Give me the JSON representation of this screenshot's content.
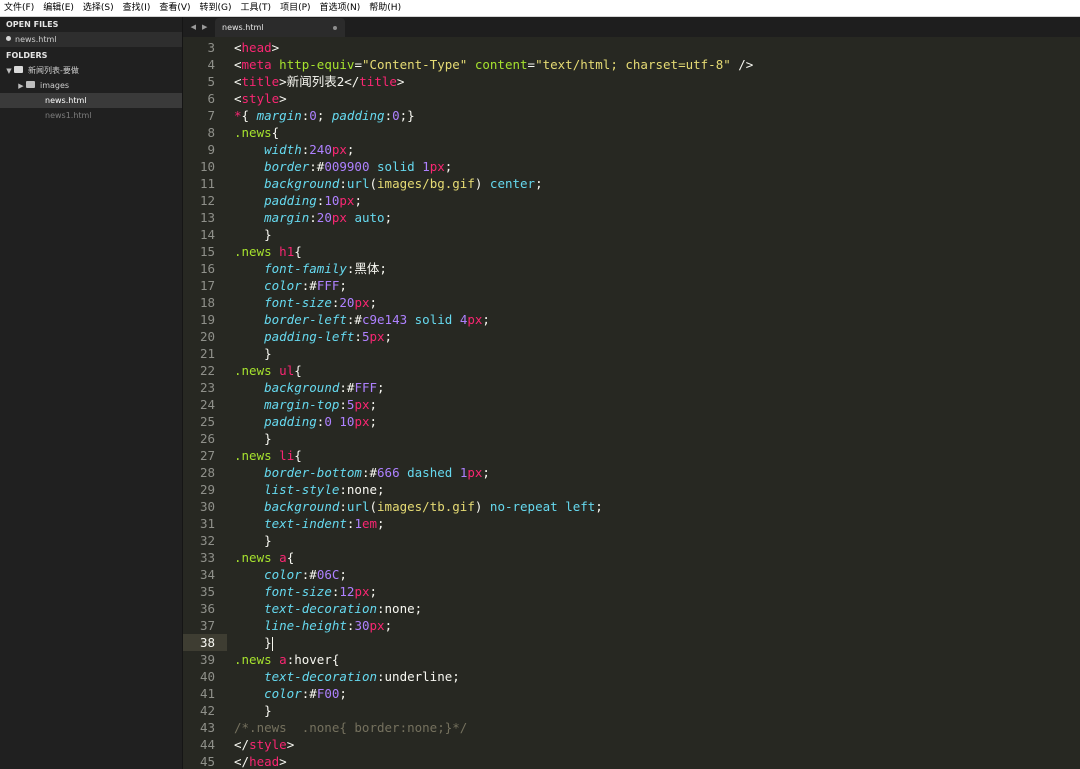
{
  "menu": [
    "文件(F)",
    "编辑(E)",
    "选择(S)",
    "查找(I)",
    "查看(V)",
    "转到(G)",
    "工具(T)",
    "项目(P)",
    "首选项(N)",
    "帮助(H)"
  ],
  "sidebar": {
    "open_files_header": "OPEN FILES",
    "open_files": [
      "news.html"
    ],
    "folders_header": "FOLDERS",
    "root_folder": "新闻列表-要做",
    "subfolder": "images",
    "files": [
      "news.html",
      "news1.html"
    ]
  },
  "tab": {
    "label": "news.html"
  },
  "editor": {
    "line_numbers": [
      "3",
      "4",
      "5",
      "6",
      "7",
      "8",
      "9",
      "10",
      "11",
      "12",
      "13",
      "14",
      "15",
      "16",
      "17",
      "18",
      "19",
      "20",
      "21",
      "22",
      "23",
      "24",
      "25",
      "26",
      "27",
      "28",
      "29",
      "30",
      "31",
      "32",
      "33",
      "34",
      "35",
      "36",
      "37",
      "38",
      "39",
      "40",
      "41",
      "42",
      "43",
      "44",
      "45"
    ],
    "active_line": "38",
    "lines": [
      [
        [
          "t",
          "<"
        ],
        [
          "tag",
          "head"
        ],
        [
          "t",
          ">"
        ]
      ],
      [
        [
          "t",
          "<"
        ],
        [
          "tag",
          "meta"
        ],
        [
          "t",
          " "
        ],
        [
          "attr",
          "http-equiv"
        ],
        [
          "t",
          "="
        ],
        [
          "str",
          "\"Content-Type\""
        ],
        [
          "t",
          " "
        ],
        [
          "attr",
          "content"
        ],
        [
          "t",
          "="
        ],
        [
          "str",
          "\"text/html; charset=utf-8\""
        ],
        [
          "t",
          " />"
        ]
      ],
      [
        [
          "t",
          "<"
        ],
        [
          "tag",
          "title"
        ],
        [
          "t",
          ">新闻列表2</"
        ],
        [
          "tag",
          "title"
        ],
        [
          "t",
          ">"
        ]
      ],
      [
        [
          "t",
          "<"
        ],
        [
          "tag",
          "style"
        ],
        [
          "t",
          ">"
        ]
      ],
      [
        [
          "tag",
          "*"
        ],
        [
          "t",
          "{ "
        ],
        [
          "prop",
          "margin"
        ],
        [
          "t",
          ":"
        ],
        [
          "num",
          "0"
        ],
        [
          "t",
          "; "
        ],
        [
          "prop",
          "padding"
        ],
        [
          "t",
          ":"
        ],
        [
          "num",
          "0"
        ],
        [
          "t",
          ";}"
        ]
      ],
      [
        [
          "sel",
          ".news"
        ],
        [
          "t",
          "{"
        ]
      ],
      [
        [
          "t",
          "    "
        ],
        [
          "prop",
          "width"
        ],
        [
          "t",
          ":"
        ],
        [
          "num",
          "240"
        ],
        [
          "unit",
          "px"
        ],
        [
          "t",
          ";"
        ]
      ],
      [
        [
          "t",
          "    "
        ],
        [
          "prop",
          "border"
        ],
        [
          "t",
          ":#"
        ],
        [
          "num",
          "009900"
        ],
        [
          "t",
          " "
        ],
        [
          "val",
          "solid"
        ],
        [
          "t",
          " "
        ],
        [
          "num",
          "1"
        ],
        [
          "unit",
          "px"
        ],
        [
          "t",
          ";"
        ]
      ],
      [
        [
          "t",
          "    "
        ],
        [
          "prop",
          "background"
        ],
        [
          "t",
          ":"
        ],
        [
          "fn",
          "url"
        ],
        [
          "t",
          "("
        ],
        [
          "str",
          "images/bg.gif"
        ],
        [
          "t",
          ") "
        ],
        [
          "val",
          "center"
        ],
        [
          "t",
          ";"
        ]
      ],
      [
        [
          "t",
          "    "
        ],
        [
          "prop",
          "padding"
        ],
        [
          "t",
          ":"
        ],
        [
          "num",
          "10"
        ],
        [
          "unit",
          "px"
        ],
        [
          "t",
          ";"
        ]
      ],
      [
        [
          "t",
          "    "
        ],
        [
          "prop",
          "margin"
        ],
        [
          "t",
          ":"
        ],
        [
          "num",
          "20"
        ],
        [
          "unit",
          "px"
        ],
        [
          "t",
          " "
        ],
        [
          "val",
          "auto"
        ],
        [
          "t",
          ";"
        ]
      ],
      [
        [
          "t",
          "    }"
        ]
      ],
      [
        [
          "sel",
          ".news"
        ],
        [
          "t",
          " "
        ],
        [
          "tag",
          "h1"
        ],
        [
          "t",
          "{"
        ]
      ],
      [
        [
          "t",
          "    "
        ],
        [
          "prop",
          "font-family"
        ],
        [
          "t",
          ":黑体;"
        ]
      ],
      [
        [
          "t",
          "    "
        ],
        [
          "prop",
          "color"
        ],
        [
          "t",
          ":#"
        ],
        [
          "num",
          "FFF"
        ],
        [
          "t",
          ";"
        ]
      ],
      [
        [
          "t",
          "    "
        ],
        [
          "prop",
          "font-size"
        ],
        [
          "t",
          ":"
        ],
        [
          "num",
          "20"
        ],
        [
          "unit",
          "px"
        ],
        [
          "t",
          ";"
        ]
      ],
      [
        [
          "t",
          "    "
        ],
        [
          "prop",
          "border-left"
        ],
        [
          "t",
          ":#"
        ],
        [
          "num",
          "c9e143"
        ],
        [
          "t",
          " "
        ],
        [
          "val",
          "solid"
        ],
        [
          "t",
          " "
        ],
        [
          "num",
          "4"
        ],
        [
          "unit",
          "px"
        ],
        [
          "t",
          ";"
        ]
      ],
      [
        [
          "t",
          "    "
        ],
        [
          "prop",
          "padding-left"
        ],
        [
          "t",
          ":"
        ],
        [
          "num",
          "5"
        ],
        [
          "unit",
          "px"
        ],
        [
          "t",
          ";"
        ]
      ],
      [
        [
          "t",
          "    }"
        ]
      ],
      [
        [
          "sel",
          ".news"
        ],
        [
          "t",
          " "
        ],
        [
          "tag",
          "ul"
        ],
        [
          "t",
          "{"
        ]
      ],
      [
        [
          "t",
          "    "
        ],
        [
          "prop",
          "background"
        ],
        [
          "t",
          ":#"
        ],
        [
          "num",
          "FFF"
        ],
        [
          "t",
          ";"
        ]
      ],
      [
        [
          "t",
          "    "
        ],
        [
          "prop",
          "margin-top"
        ],
        [
          "t",
          ":"
        ],
        [
          "num",
          "5"
        ],
        [
          "unit",
          "px"
        ],
        [
          "t",
          ";"
        ]
      ],
      [
        [
          "t",
          "    "
        ],
        [
          "prop",
          "padding"
        ],
        [
          "t",
          ":"
        ],
        [
          "num",
          "0"
        ],
        [
          "t",
          " "
        ],
        [
          "num",
          "10"
        ],
        [
          "unit",
          "px"
        ],
        [
          "t",
          ";"
        ]
      ],
      [
        [
          "t",
          "    }"
        ]
      ],
      [
        [
          "sel",
          ".news"
        ],
        [
          "t",
          " "
        ],
        [
          "tag",
          "li"
        ],
        [
          "t",
          "{"
        ]
      ],
      [
        [
          "t",
          "    "
        ],
        [
          "prop",
          "border-bottom"
        ],
        [
          "t",
          ":#"
        ],
        [
          "num",
          "666"
        ],
        [
          "t",
          " "
        ],
        [
          "val",
          "dashed"
        ],
        [
          "t",
          " "
        ],
        [
          "num",
          "1"
        ],
        [
          "unit",
          "px"
        ],
        [
          "t",
          ";"
        ]
      ],
      [
        [
          "t",
          "    "
        ],
        [
          "prop",
          "list-style"
        ],
        [
          "t",
          ":none;"
        ]
      ],
      [
        [
          "t",
          "    "
        ],
        [
          "prop",
          "background"
        ],
        [
          "t",
          ":"
        ],
        [
          "fn",
          "url"
        ],
        [
          "t",
          "("
        ],
        [
          "str",
          "images/tb.gif"
        ],
        [
          "t",
          ") "
        ],
        [
          "val",
          "no-repeat"
        ],
        [
          "t",
          " "
        ],
        [
          "val",
          "left"
        ],
        [
          "t",
          ";"
        ]
      ],
      [
        [
          "t",
          "    "
        ],
        [
          "prop",
          "text-indent"
        ],
        [
          "t",
          ":"
        ],
        [
          "num",
          "1"
        ],
        [
          "unit",
          "em"
        ],
        [
          "t",
          ";"
        ]
      ],
      [
        [
          "t",
          "    }"
        ]
      ],
      [
        [
          "sel",
          ".news"
        ],
        [
          "t",
          " "
        ],
        [
          "tag",
          "a"
        ],
        [
          "t",
          "{"
        ]
      ],
      [
        [
          "t",
          "    "
        ],
        [
          "prop",
          "color"
        ],
        [
          "t",
          ":#"
        ],
        [
          "num",
          "06C"
        ],
        [
          "t",
          ";"
        ]
      ],
      [
        [
          "t",
          "    "
        ],
        [
          "prop",
          "font-size"
        ],
        [
          "t",
          ":"
        ],
        [
          "num",
          "12"
        ],
        [
          "unit",
          "px"
        ],
        [
          "t",
          ";"
        ]
      ],
      [
        [
          "t",
          "    "
        ],
        [
          "prop",
          "text-decoration"
        ],
        [
          "t",
          ":none;"
        ]
      ],
      [
        [
          "t",
          "    "
        ],
        [
          "prop",
          "line-height"
        ],
        [
          "t",
          ":"
        ],
        [
          "num",
          "30"
        ],
        [
          "unit",
          "px"
        ],
        [
          "t",
          ";"
        ]
      ],
      [
        [
          "t",
          "    }"
        ]
      ],
      [
        [
          "sel",
          ".news"
        ],
        [
          "t",
          " "
        ],
        [
          "tag",
          "a"
        ],
        [
          "t",
          ":hover{"
        ]
      ],
      [
        [
          "t",
          "    "
        ],
        [
          "prop",
          "text-decoration"
        ],
        [
          "t",
          ":underline;"
        ]
      ],
      [
        [
          "t",
          "    "
        ],
        [
          "prop",
          "color"
        ],
        [
          "t",
          ":#"
        ],
        [
          "num",
          "F00"
        ],
        [
          "t",
          ";"
        ]
      ],
      [
        [
          "t",
          "    }"
        ]
      ],
      [
        [
          "comment",
          "/*.news  .none{ border:none;}*/"
        ]
      ],
      [
        [
          "t",
          "</"
        ],
        [
          "tag",
          "style"
        ],
        [
          "t",
          ">"
        ]
      ],
      [
        [
          "t",
          "</"
        ],
        [
          "tag",
          "head"
        ],
        [
          "t",
          ">"
        ]
      ]
    ]
  },
  "colors": {
    "background": "#272822",
    "tag": "#f92672",
    "attribute": "#a6e22e",
    "string": "#e6db74",
    "property": "#66d9ef",
    "number": "#ae81ff",
    "comment": "#75715e"
  }
}
